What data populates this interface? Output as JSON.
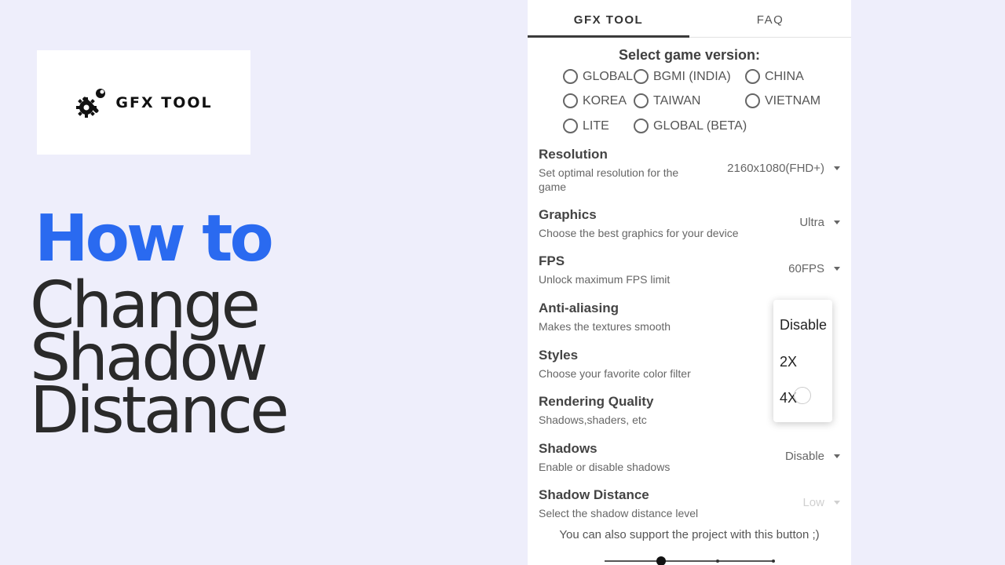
{
  "logo": {
    "text": "GFX TOOL",
    "icon": "wrench-gear-icon"
  },
  "headline": {
    "line1": "How to",
    "line2": "Change",
    "line3": "Shadow",
    "line4": "Distance"
  },
  "colors": {
    "accent": "#2a6af0",
    "background": "#eeeefb"
  },
  "tabs": [
    {
      "label": "GFX TOOL",
      "active": true
    },
    {
      "label": "FAQ",
      "active": false
    }
  ],
  "version": {
    "title": "Select game version:",
    "options": [
      "GLOBAL",
      "BGMI (INDIA)",
      "CHINA",
      "KOREA",
      "TAIWAN",
      "VIETNAM",
      "LITE",
      "GLOBAL (BETA)"
    ]
  },
  "settings": {
    "resolution": {
      "title": "Resolution",
      "desc": "Set optimal resolution for the game",
      "value": "2160x1080(FHD+)"
    },
    "graphics": {
      "title": "Graphics",
      "desc": "Choose the best graphics for your device",
      "value": "Ultra"
    },
    "fps": {
      "title": "FPS",
      "desc": "Unlock maximum FPS limit",
      "value": "60FPS"
    },
    "antialiasing": {
      "title": "Anti-aliasing",
      "desc": "Makes the textures smooth"
    },
    "styles": {
      "title": "Styles",
      "desc": "Choose your favorite color filter"
    },
    "rendering": {
      "title": "Rendering Quality",
      "desc": "Shadows,shaders, etc"
    },
    "shadows": {
      "title": "Shadows",
      "desc": "Enable or disable shadows",
      "value": "Disable"
    },
    "shadow_distance": {
      "title": "Shadow Distance",
      "desc": "Select the shadow distance level",
      "value": "Low"
    }
  },
  "dropdown": {
    "options": [
      "Disable",
      "2X",
      "4X"
    ]
  },
  "support": {
    "text": "You can also support the project with this button ;)"
  }
}
